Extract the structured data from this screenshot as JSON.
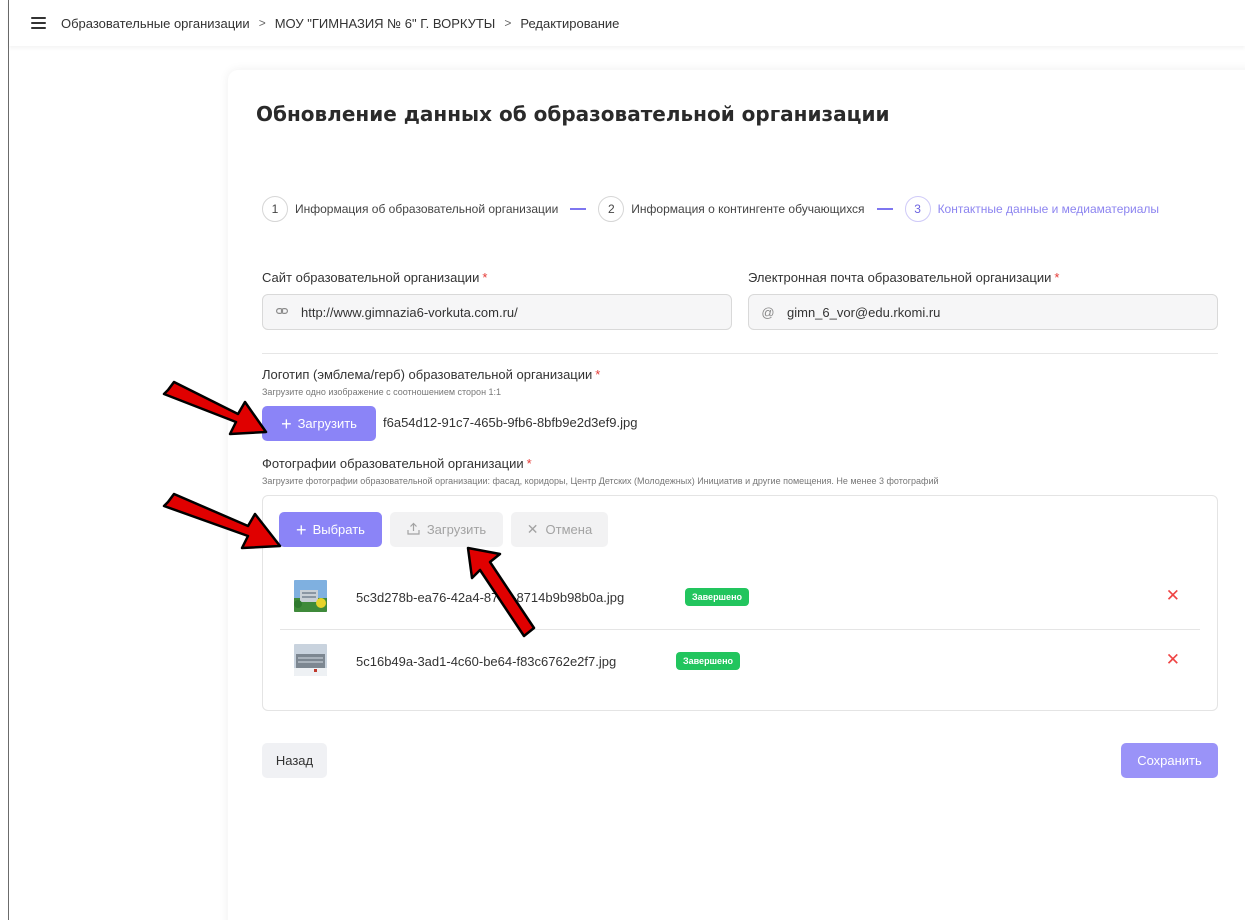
{
  "breadcrumb": {
    "item1": "Образовательные организации",
    "item2": "МОУ \"ГИМНАЗИЯ № 6\" Г. ВОРКУТЫ",
    "item3": "Редактирование",
    "separator": ">"
  },
  "page": {
    "title": "Обновление данных об образовательной организации"
  },
  "steps": [
    {
      "number": "1",
      "label": "Информация об образовательной организации",
      "active": false
    },
    {
      "number": "2",
      "label": "Информация о контингенте обучающихся",
      "active": false
    },
    {
      "number": "3",
      "label": "Контактные данные и медиаматериалы",
      "active": true
    }
  ],
  "form": {
    "site": {
      "label": "Сайт образовательной организации",
      "required_mark": "*",
      "value": "http://www.gimnazia6-vorkuta.com.ru/",
      "icon": "link-icon"
    },
    "email": {
      "label": "Электронная почта образовательной организации",
      "required_mark": "*",
      "value": "gimn_6_vor@edu.rkomi.ru",
      "icon": "at-icon"
    },
    "logo": {
      "label": "Логотип (эмблема/герб) образовательной организации",
      "required_mark": "*",
      "hint": "Загрузите одно изображение с соотношением сторон 1:1",
      "upload_label": "Загрузить",
      "filename": "f6a54d12-91c7-465b-9fb6-8bfb9e2d3ef9.jpg"
    },
    "photos": {
      "label": "Фотографии образовательной организации",
      "required_mark": "*",
      "hint": "Загрузите фотографии образовательной организации: фасад, коридоры, Центр Детских (Молодежных) Инициатив и другие помещения. Не менее 3 фотографий",
      "choose_label": "Выбрать",
      "upload_label": "Загрузить",
      "cancel_label": "Отмена",
      "files": [
        {
          "name": "5c3d278b-ea76-42a4-87c7-8714b9b98b0a.jpg",
          "status": "Завершено"
        },
        {
          "name": "5c16b49a-3ad1-4c60-be64-f83c6762e2f7.jpg",
          "status": "Завершено"
        }
      ]
    }
  },
  "actions": {
    "back_label": "Назад",
    "save_label": "Сохранить"
  },
  "colors": {
    "accent": "#8b84f7",
    "success": "#22c55e",
    "danger": "#ef4444",
    "annotation_arrow": "#e00000"
  }
}
